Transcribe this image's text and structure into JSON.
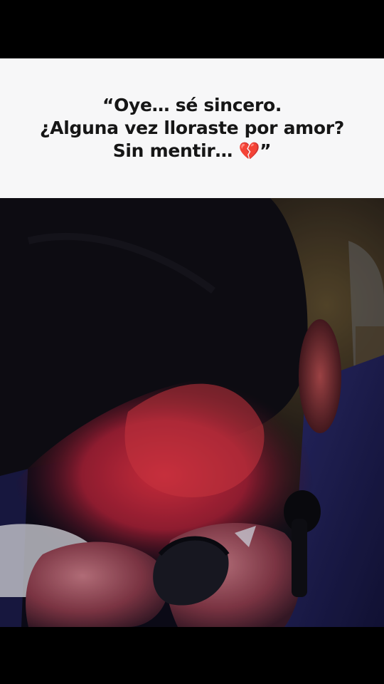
{
  "caption": {
    "line1": "“Oye… sé sincero.",
    "line2": "¿Alguna vez lloraste por amor?",
    "line3_text": "Sin mentir… ",
    "line3_emoji": "💔",
    "line3_close": "”"
  },
  "scene": {
    "subject": "man crying covering his face with a hand while holding a microphone",
    "lighting_color": "#c0243a",
    "background_color": "#0c0b16"
  }
}
